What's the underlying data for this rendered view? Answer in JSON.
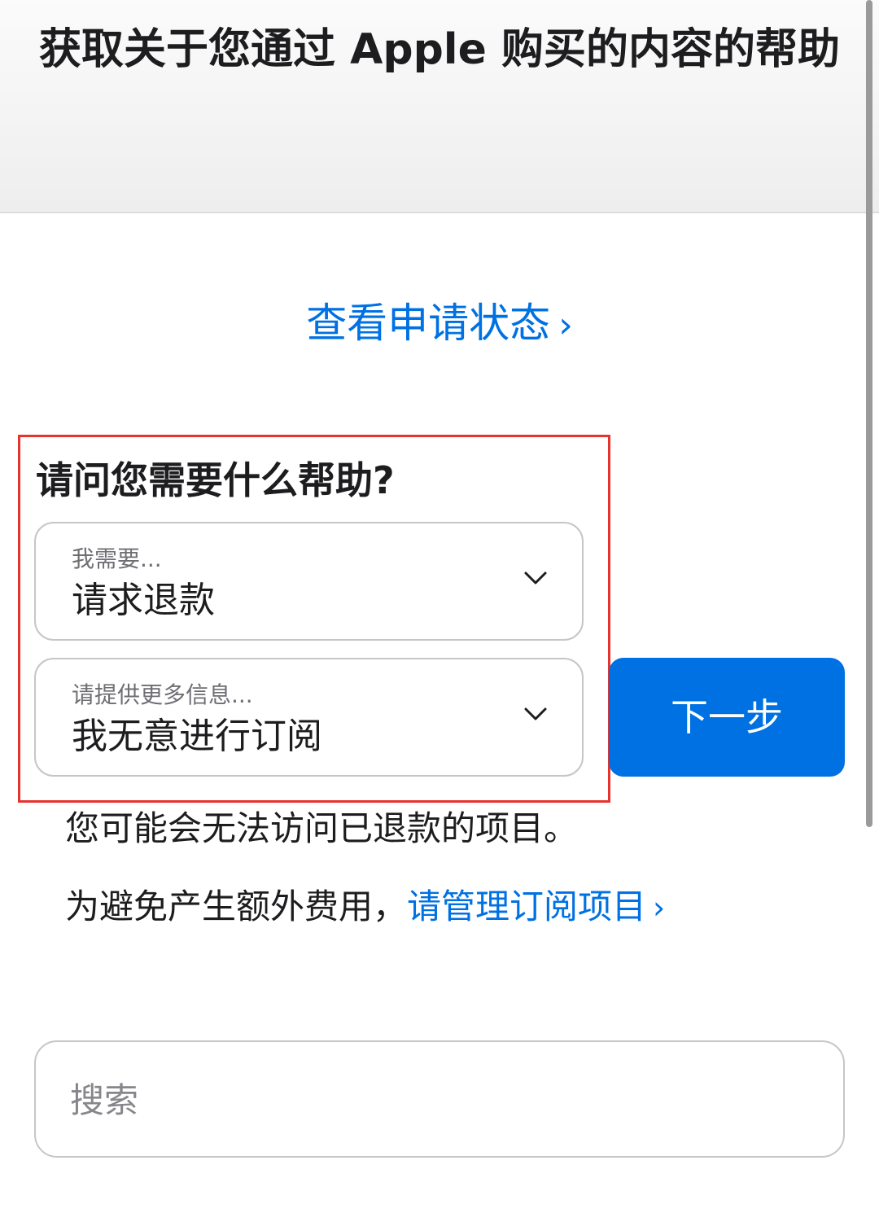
{
  "header": {
    "title": "获取关于您通过 Apple 购买的内容的帮助"
  },
  "status_link": {
    "label": "查看申请状态",
    "chevron": "›"
  },
  "form": {
    "question": "请问您需要什么帮助?",
    "need_select": {
      "label": "我需要...",
      "value": "请求退款"
    },
    "detail_select": {
      "label": "请提供更多信息...",
      "value": "我无意进行订阅"
    },
    "next_button": "下一步"
  },
  "info": {
    "line1": "您可能会无法访问已退款的项目。",
    "line2_prefix": "为避免产生额外费用，",
    "manage_link": "请管理订阅项目",
    "manage_chevron": "›"
  },
  "search": {
    "placeholder": "搜索"
  },
  "colors": {
    "accent": "#0071e3",
    "highlight": "#e8322c"
  },
  "icons": {
    "dropdown": "chevron-down-icon",
    "link": "chevron-right-icon"
  }
}
